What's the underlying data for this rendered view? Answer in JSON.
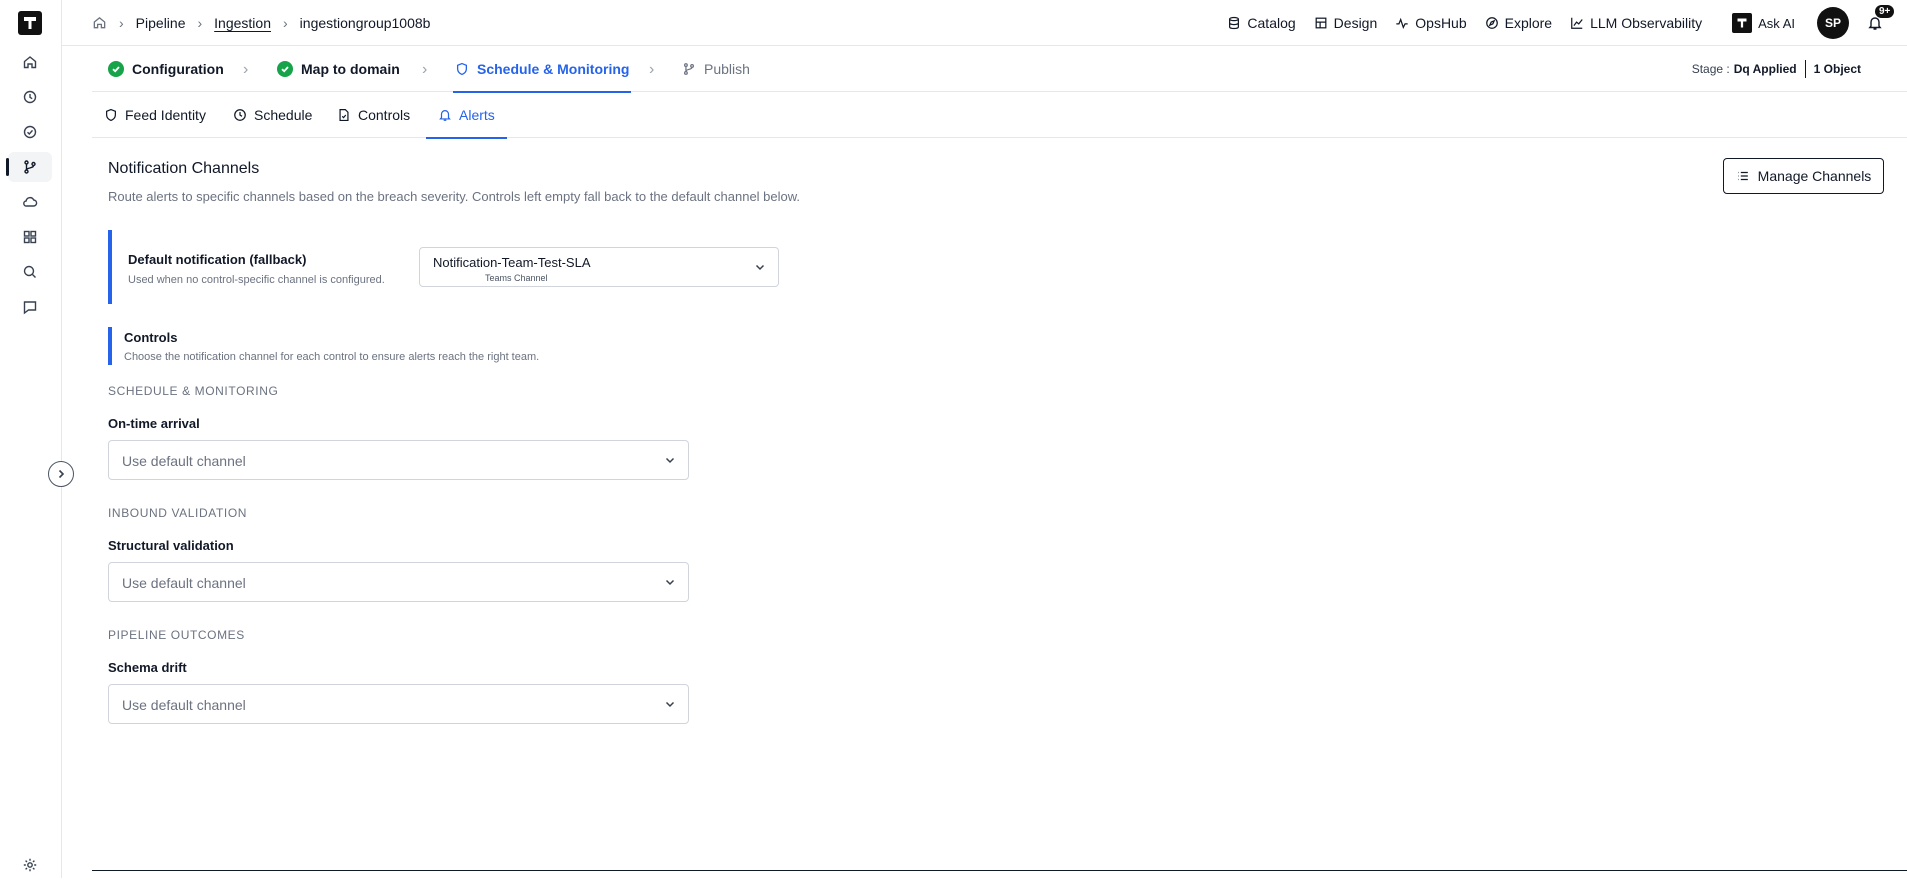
{
  "breadcrumb": {
    "items": [
      "Pipeline",
      "Ingestion",
      "ingestiongroup1008b"
    ]
  },
  "topnav": {
    "catalog": "Catalog",
    "design": "Design",
    "opshub": "OpsHub",
    "explore": "Explore",
    "llm": "LLM Observability",
    "ask_ai": "Ask AI",
    "avatar_initials": "SP",
    "notifications_badge": "9+"
  },
  "stepper": {
    "steps": [
      {
        "label": "Configuration",
        "state": "done"
      },
      {
        "label": "Map to domain",
        "state": "done"
      },
      {
        "label": "Schedule & Monitoring",
        "state": "active"
      },
      {
        "label": "Publish",
        "state": "pending"
      }
    ],
    "stage_label": "Stage :",
    "stage_value": "Dq Applied",
    "object_count": "1 Object"
  },
  "subtabs": {
    "items": [
      {
        "label": "Feed Identity",
        "active": false
      },
      {
        "label": "Schedule",
        "active": false
      },
      {
        "label": "Controls",
        "active": false
      },
      {
        "label": "Alerts",
        "active": true
      }
    ]
  },
  "main": {
    "title": "Notification Channels",
    "description": "Route alerts to specific channels based on the breach severity. Controls left empty fall back to the default channel below.",
    "manage_button": "Manage Channels",
    "fallback": {
      "title": "Default notification (fallback)",
      "subtitle": "Used when no control-specific channel is configured.",
      "selected_value": "Notification-Team-Test-SLA",
      "selected_type": "Teams Channel"
    },
    "controls": {
      "title": "Controls",
      "subtitle": "Choose the notification channel for each control to ensure alerts reach the right team."
    },
    "groups": [
      {
        "heading": "SCHEDULE & MONITORING",
        "control": "On-time arrival",
        "value": "Use default channel"
      },
      {
        "heading": "INBOUND VALIDATION",
        "control": "Structural validation",
        "value": "Use default channel"
      },
      {
        "heading": "PIPELINE OUTCOMES",
        "control": "Schema drift",
        "value": "Use default channel"
      }
    ]
  },
  "colors": {
    "accent": "#2563eb",
    "success": "#16a34a",
    "text_muted": "#6b7280"
  }
}
